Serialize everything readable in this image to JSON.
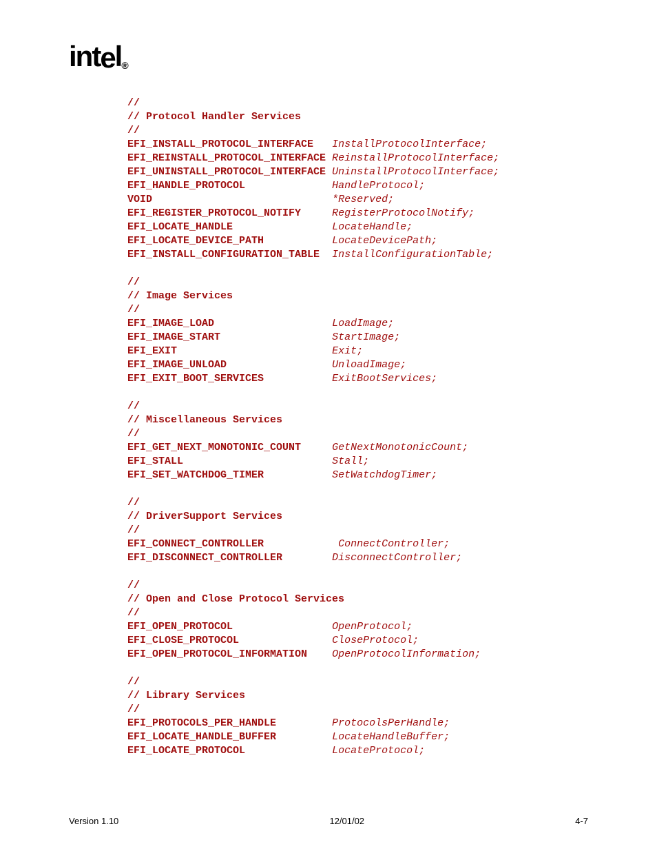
{
  "logo": "intel",
  "footer": {
    "left": "Version 1.10",
    "center": "12/01/02",
    "right": "4-7"
  },
  "sections": [
    {
      "comment": [
        "//",
        "// Protocol Handler Services",
        "//"
      ],
      "items": [
        {
          "type": "EFI_INSTALL_PROTOCOL_INTERFACE",
          "pad": "   ",
          "name": "InstallProtocolInterface;"
        },
        {
          "type": "EFI_REINSTALL_PROTOCOL_INTERFACE",
          "pad": " ",
          "name": "ReinstallProtocolInterface;"
        },
        {
          "type": "EFI_UNINSTALL_PROTOCOL_INTERFACE",
          "pad": " ",
          "name": "UninstallProtocolInterface;"
        },
        {
          "type": "EFI_HANDLE_PROTOCOL",
          "pad": "              ",
          "name": "HandleProtocol;"
        },
        {
          "type": "VOID",
          "pad": "                             ",
          "name": "*Reserved;"
        },
        {
          "type": "EFI_REGISTER_PROTOCOL_NOTIFY",
          "pad": "     ",
          "name": "RegisterProtocolNotify;"
        },
        {
          "type": "EFI_LOCATE_HANDLE",
          "pad": "                ",
          "name": "LocateHandle;"
        },
        {
          "type": "EFI_LOCATE_DEVICE_PATH",
          "pad": "           ",
          "name": "LocateDevicePath;"
        },
        {
          "type": "EFI_INSTALL_CONFIGURATION_TABLE",
          "pad": "  ",
          "name": "InstallConfigurationTable;"
        }
      ]
    },
    {
      "comment": [
        "//",
        "// Image Services",
        "//"
      ],
      "items": [
        {
          "type": "EFI_IMAGE_LOAD",
          "pad": "                   ",
          "name": "LoadImage;"
        },
        {
          "type": "EFI_IMAGE_START",
          "pad": "                  ",
          "name": "StartImage;"
        },
        {
          "type": "EFI_EXIT",
          "pad": "                         ",
          "name": "Exit;"
        },
        {
          "type": "EFI_IMAGE_UNLOAD",
          "pad": "                 ",
          "name": "UnloadImage;"
        },
        {
          "type": "EFI_EXIT_BOOT_SERVICES",
          "pad": "           ",
          "name": "ExitBootServices;"
        }
      ]
    },
    {
      "comment": [
        "//",
        "// Miscellaneous Services",
        "//"
      ],
      "items": [
        {
          "type": "EFI_GET_NEXT_MONOTONIC_COUNT",
          "pad": "     ",
          "name": "GetNextMonotonicCount;"
        },
        {
          "type": "EFI_STALL",
          "pad": "                        ",
          "name": "Stall;"
        },
        {
          "type": "EFI_SET_WATCHDOG_TIMER",
          "pad": "           ",
          "name": "SetWatchdogTimer;"
        }
      ]
    },
    {
      "comment": [
        "//",
        "// DriverSupport Services",
        "//"
      ],
      "items": [
        {
          "type": "EFI_CONNECT_CONTROLLER",
          "pad": "            ",
          "name": "ConnectController;"
        },
        {
          "type": "EFI_DISCONNECT_CONTROLLER",
          "pad": "        ",
          "name": "DisconnectController;"
        }
      ]
    },
    {
      "comment": [
        "//",
        "// Open and Close Protocol Services",
        "//"
      ],
      "items": [
        {
          "type": "EFI_OPEN_PROTOCOL",
          "pad": "                ",
          "name": "OpenProtocol;"
        },
        {
          "type": "EFI_CLOSE_PROTOCOL",
          "pad": "               ",
          "name": "CloseProtocol;"
        },
        {
          "type": "EFI_OPEN_PROTOCOL_INFORMATION",
          "pad": "    ",
          "name": "OpenProtocolInformation;"
        }
      ]
    },
    {
      "comment": [
        "//",
        "// Library Services",
        "//"
      ],
      "items": [
        {
          "type": "EFI_PROTOCOLS_PER_HANDLE",
          "pad": "         ",
          "name": "ProtocolsPerHandle;"
        },
        {
          "type": "EFI_LOCATE_HANDLE_BUFFER",
          "pad": "         ",
          "name": "LocateHandleBuffer;"
        },
        {
          "type": "EFI_LOCATE_PROTOCOL",
          "pad": "              ",
          "name": "LocateProtocol;"
        }
      ]
    }
  ]
}
